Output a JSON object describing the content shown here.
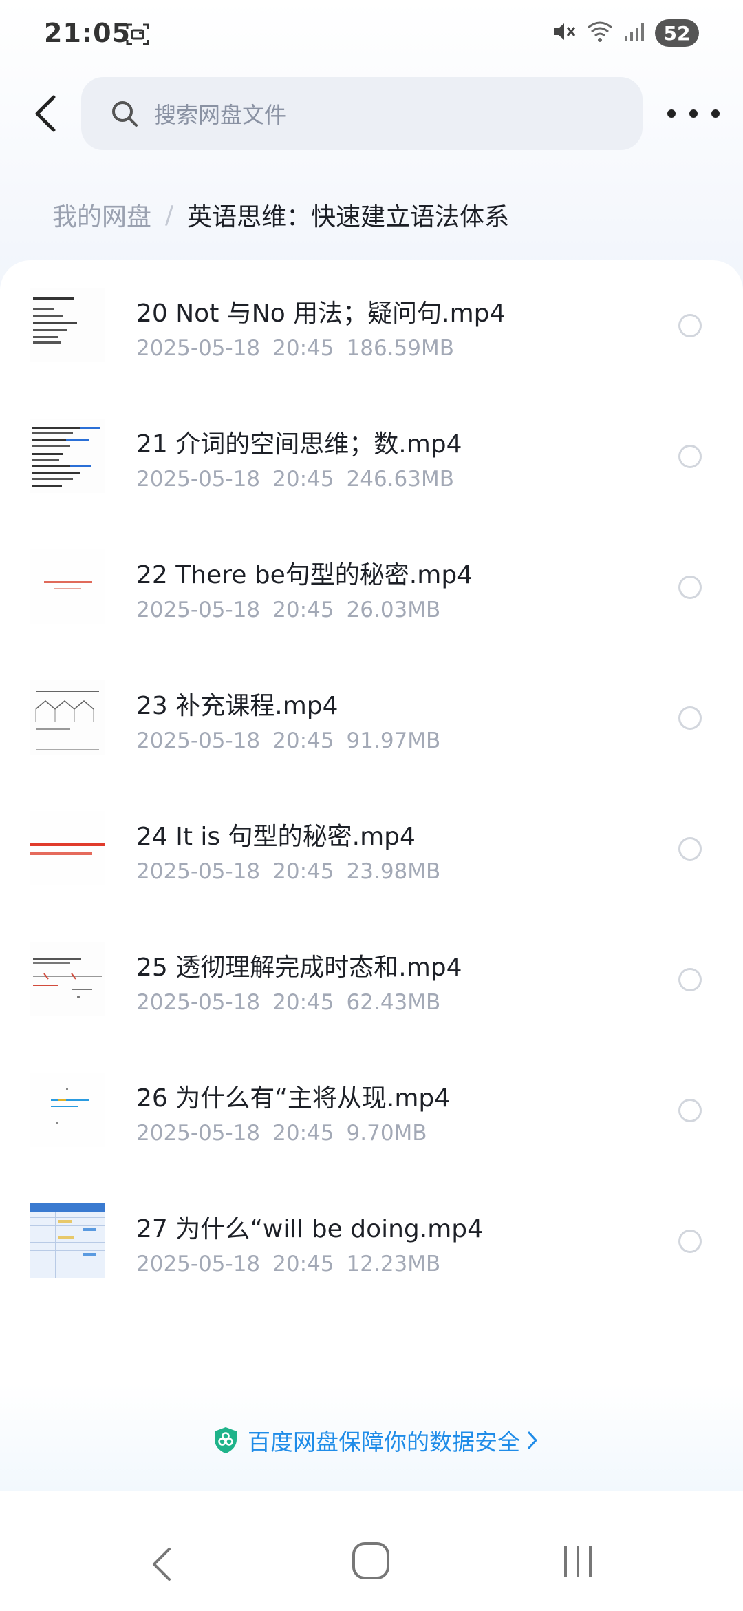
{
  "status_bar": {
    "time": "21:05",
    "battery": "52",
    "icons": [
      "screenshot-icon",
      "mute-icon",
      "wifi-icon",
      "signal-icon"
    ]
  },
  "header": {
    "search_placeholder": "搜索网盘文件"
  },
  "breadcrumb": {
    "root": "我的网盘",
    "separator": "/",
    "current": "英语思维：快速建立语法体系"
  },
  "files": [
    {
      "name": "20 Not 与No 用法；疑问句.mp4",
      "date": "2025-05-18",
      "time": "20:45",
      "size": "186.59MB"
    },
    {
      "name": "21 介词的空间思维；数.mp4",
      "date": "2025-05-18",
      "time": "20:45",
      "size": "246.63MB"
    },
    {
      "name": "22 There be句型的秘密.mp4",
      "date": "2025-05-18",
      "time": "20:45",
      "size": "26.03MB"
    },
    {
      "name": "23 补充课程.mp4",
      "date": "2025-05-18",
      "time": "20:45",
      "size": "91.97MB"
    },
    {
      "name": "24 It is 句型的秘密.mp4",
      "date": "2025-05-18",
      "time": "20:45",
      "size": "23.98MB"
    },
    {
      "name": "25 透彻理解完成时态和.mp4",
      "date": "2025-05-18",
      "time": "20:45",
      "size": "62.43MB"
    },
    {
      "name": "26 为什么有“主将从现.mp4",
      "date": "2025-05-18",
      "time": "20:45",
      "size": "9.70MB"
    },
    {
      "name": "27 为什么“will be doing.mp4",
      "date": "2025-05-18",
      "time": "20:45",
      "size": "12.23MB"
    }
  ],
  "footer": {
    "security_text": "百度网盘保障你的数据安全"
  },
  "colors": {
    "accent": "#1f8ce8",
    "muted_text": "#a3a9b6",
    "search_bg": "#eceff5"
  }
}
